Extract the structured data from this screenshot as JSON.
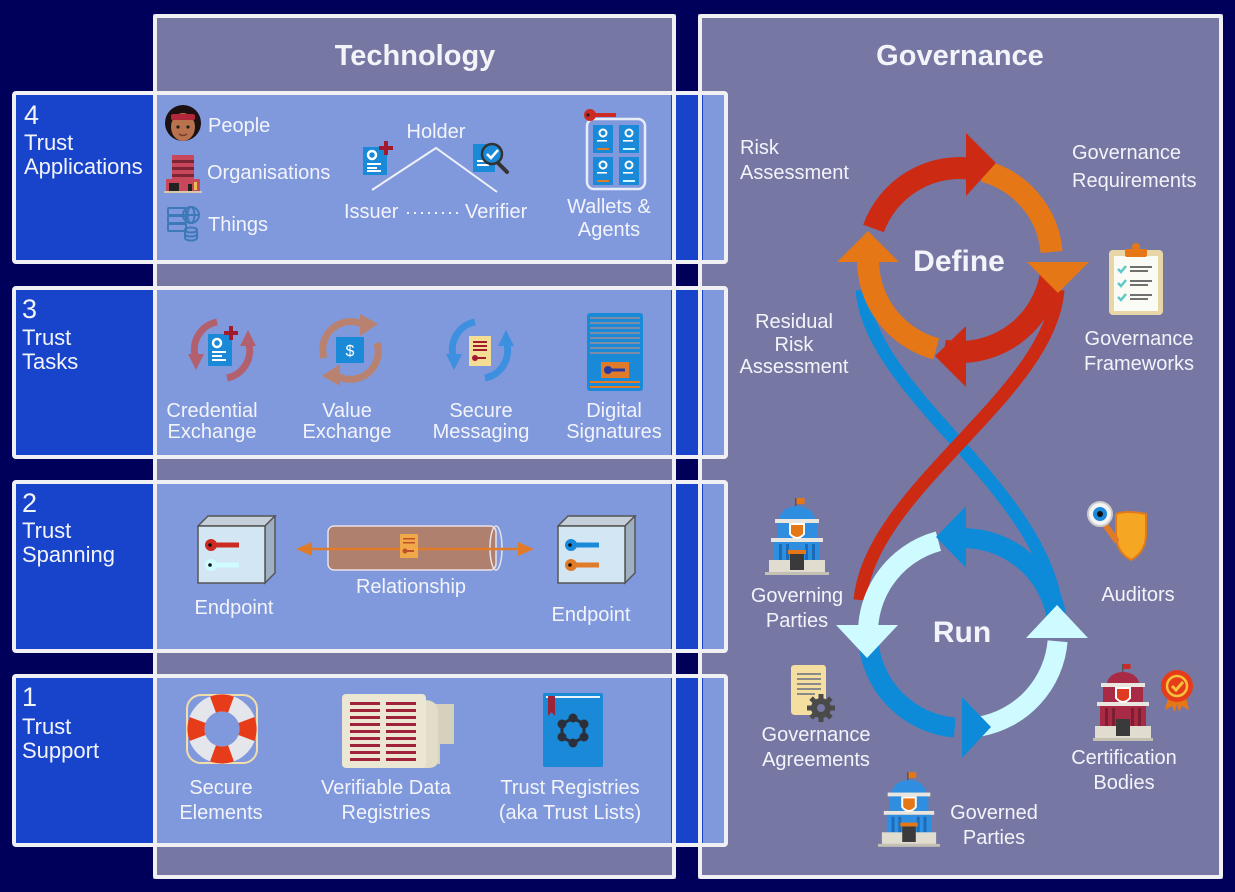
{
  "columns": {
    "technology_title": "Technology",
    "governance_title": "Governance"
  },
  "layers": [
    {
      "number": "4",
      "name_lines": [
        "Trust",
        "Applications"
      ]
    },
    {
      "number": "3",
      "name_lines": [
        "Trust",
        "Tasks"
      ]
    },
    {
      "number": "2",
      "name_lines": [
        "Trust",
        "Spanning"
      ]
    },
    {
      "number": "1",
      "name_lines": [
        "Trust",
        "Support"
      ]
    }
  ],
  "technology": {
    "trust_applications": {
      "entities": [
        {
          "label": "People",
          "icon": "person-avatar-icon"
        },
        {
          "label": "Organisations",
          "icon": "organisation-building-icon"
        },
        {
          "label": "Things",
          "icon": "devices-icon"
        }
      ],
      "credential_triangle": {
        "holder": "Holder",
        "issuer": "Issuer",
        "verifier": "Verifier",
        "issuer_icon": "issue-credential-icon",
        "verifier_icon": "verify-credential-icon"
      },
      "wallets": {
        "label_lines": [
          "Wallets &",
          "Agents"
        ],
        "icon": "wallet-icon"
      }
    },
    "trust_tasks": [
      {
        "label_lines": [
          "Credential",
          "Exchange"
        ],
        "icon": "credential-exchange-icon"
      },
      {
        "label_lines": [
          "Value",
          "Exchange"
        ],
        "icon": "value-exchange-icon"
      },
      {
        "label_lines": [
          "Secure",
          "Messaging"
        ],
        "icon": "secure-messaging-icon"
      },
      {
        "label_lines": [
          "Digital",
          "Signatures"
        ],
        "icon": "digital-signature-icon"
      }
    ],
    "trust_spanning": {
      "left_endpoint": "Endpoint",
      "relationship": "Relationship",
      "right_endpoint": "Endpoint",
      "endpoint_icon": "endpoint-box-icon",
      "relationship_icon": "relationship-tunnel-icon"
    },
    "trust_support": [
      {
        "label_lines": [
          "Secure",
          "Elements"
        ],
        "icon": "lifebuoy-icon"
      },
      {
        "label_lines": [
          "Verifiable Data",
          "Registries"
        ],
        "icon": "ledger-scroll-icon"
      },
      {
        "label_lines": [
          "Trust Registries",
          "(aka Trust Lists)"
        ],
        "icon": "registry-book-icon"
      }
    ]
  },
  "governance": {
    "define_label": "Define",
    "run_label": "Run",
    "define_items": [
      {
        "label_lines": [
          "Risk",
          "Assessment"
        ]
      },
      {
        "label_lines": [
          "Governance",
          "Requirements"
        ]
      },
      {
        "label_lines": [
          "Governance",
          "Frameworks"
        ],
        "icon": "clipboard-checklist-icon"
      },
      {
        "label_lines": [
          "Residual",
          "Risk",
          "Assessment"
        ]
      }
    ],
    "run_items": [
      {
        "label_lines": [
          "Governing",
          "Parties"
        ],
        "icon": "government-building-icon"
      },
      {
        "label_lines": [
          "Auditors"
        ],
        "icon": "auditor-magnifier-shield-icon"
      },
      {
        "label_lines": [
          "Governance",
          "Agreements"
        ],
        "icon": "agreement-scroll-gear-icon"
      },
      {
        "label_lines": [
          "Certification",
          "Bodies"
        ],
        "icon": "certification-building-badge-icon"
      },
      {
        "label_lines": [
          "Governed",
          "Parties"
        ],
        "icon": "governed-building-icon"
      }
    ]
  },
  "colors": {
    "background": "#00005a",
    "column_fill": "#7777a3",
    "layer_label_fill": "#1844cc",
    "layer_content_fill": "#8099dc",
    "border": "#f0f0f4",
    "define_red": "#cc2a12",
    "define_orange": "#e57716",
    "run_blue": "#0e8bd8",
    "run_cyan": "#cdfbff"
  }
}
